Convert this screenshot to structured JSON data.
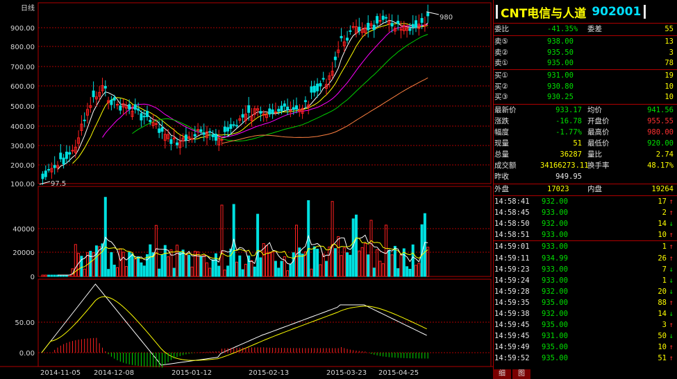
{
  "left_panel": {
    "period_label": "日线",
    "price_axis": [
      "900.00",
      "800.00",
      "700.00",
      "600.00",
      "500.00",
      "400.00",
      "300.00",
      "200.00",
      "100.00"
    ],
    "volume_axis": [
      "40000",
      "20000",
      "0"
    ],
    "macd_axis": [
      "50.00",
      "0.00"
    ],
    "date_axis": [
      "2014-11-05",
      "2014-12-08",
      "2015-01-12",
      "2015-02-13",
      "2015-03-23",
      "2015-04-25"
    ],
    "high_marker": "980",
    "low_marker": "97.5"
  },
  "right_panel": {
    "title": "CNT电信与人道",
    "code": "902001",
    "wei": {
      "bi_label": "委比",
      "bi_value": "-41.35%",
      "cha_label": "委差",
      "cha_value": "55"
    },
    "asks": [
      {
        "label": "卖⑤",
        "price": "938.00",
        "volume": "13"
      },
      {
        "label": "卖②",
        "price": "935.50",
        "volume": "3"
      },
      {
        "label": "卖①",
        "price": "935.00",
        "volume": "78"
      }
    ],
    "bids": [
      {
        "label": "买①",
        "price": "931.00",
        "volume": "19"
      },
      {
        "label": "买②",
        "price": "930.80",
        "volume": "10"
      },
      {
        "label": "买③",
        "price": "930.25",
        "volume": "10"
      }
    ],
    "stats": [
      {
        "l1": "最新价",
        "v1": "933.17",
        "c1": "green",
        "l2": "均价",
        "v2": "941.56",
        "c2": "green"
      },
      {
        "l1": "涨跌",
        "v1": "-16.78",
        "c1": "green",
        "l2": "开盘价",
        "v2": "955.55",
        "c2": "red"
      },
      {
        "l1": "幅度",
        "v1": "-1.77%",
        "c1": "green",
        "l2": "最高价",
        "v2": "980.00",
        "c2": "red"
      },
      {
        "l1": "现量",
        "v1": "51",
        "c1": "yellow",
        "l2": "最低价",
        "v2": "920.00",
        "c2": "green"
      },
      {
        "l1": "总量",
        "v1": "36287",
        "c1": "yellow",
        "l2": "量比",
        "v2": "2.74",
        "c2": "yellow"
      },
      {
        "l1": "成交额",
        "v1": "34166273.11",
        "c1": "yellow",
        "l2": "换手率",
        "v2": "48.17%",
        "c2": "yellow"
      },
      {
        "l1": "昨收",
        "v1": "949.95",
        "c1": "white",
        "l2": "",
        "v2": "",
        "c2": "white"
      }
    ],
    "outer": {
      "label": "外盘",
      "value": "17023",
      "inner_label": "内盘",
      "inner_value": "19264"
    },
    "ticks": [
      {
        "time": "14:58:41",
        "price": "932.00",
        "vol": "17",
        "dir": "↑",
        "color": "red"
      },
      {
        "time": "14:58:45",
        "price": "933.00",
        "vol": "2",
        "dir": "↑",
        "color": "red"
      },
      {
        "time": "14:58:50",
        "price": "932.00",
        "vol": "14",
        "dir": "↓",
        "color": "green"
      },
      {
        "time": "14:58:51",
        "price": "933.00",
        "vol": "10",
        "dir": "↑",
        "color": "red"
      },
      {
        "time": "14:59:01",
        "price": "933.00",
        "vol": "1",
        "dir": "↑",
        "color": "red"
      },
      {
        "time": "14:59:11",
        "price": "934.99",
        "vol": "26",
        "dir": "↑",
        "color": "red"
      },
      {
        "time": "14:59:23",
        "price": "933.00",
        "vol": "7",
        "dir": "↓",
        "color": "green"
      },
      {
        "time": "14:59:24",
        "price": "933.00",
        "vol": "1",
        "dir": "↓",
        "color": "green"
      },
      {
        "time": "14:59:28",
        "price": "932.00",
        "vol": "20",
        "dir": "↓",
        "color": "green"
      },
      {
        "time": "14:59:35",
        "price": "935.00",
        "vol": "88",
        "dir": "↑",
        "color": "red"
      },
      {
        "time": "14:59:38",
        "price": "932.00",
        "vol": "14",
        "dir": "↓",
        "color": "green"
      },
      {
        "time": "14:59:45",
        "price": "935.00",
        "vol": "3",
        "dir": "↑",
        "color": "red"
      },
      {
        "time": "14:59:45",
        "price": "931.00",
        "vol": "50",
        "dir": "↓",
        "color": "green"
      },
      {
        "time": "14:59:49",
        "price": "935.00",
        "vol": "10",
        "dir": "↑",
        "color": "red"
      },
      {
        "time": "14:59:52",
        "price": "935.00",
        "vol": "51",
        "dir": "↑",
        "color": "red"
      }
    ],
    "tabs": [
      "细",
      "图"
    ]
  },
  "colors": {
    "grid": "#b00000",
    "up": "#ff2020",
    "down": "#00e0e0",
    "ma5": "#ffffff",
    "ma10": "#ffff00",
    "ma20": "#ff00ff",
    "ma30": "#00d000",
    "ma60": "#ff8040",
    "accent": "#ffff00"
  }
}
